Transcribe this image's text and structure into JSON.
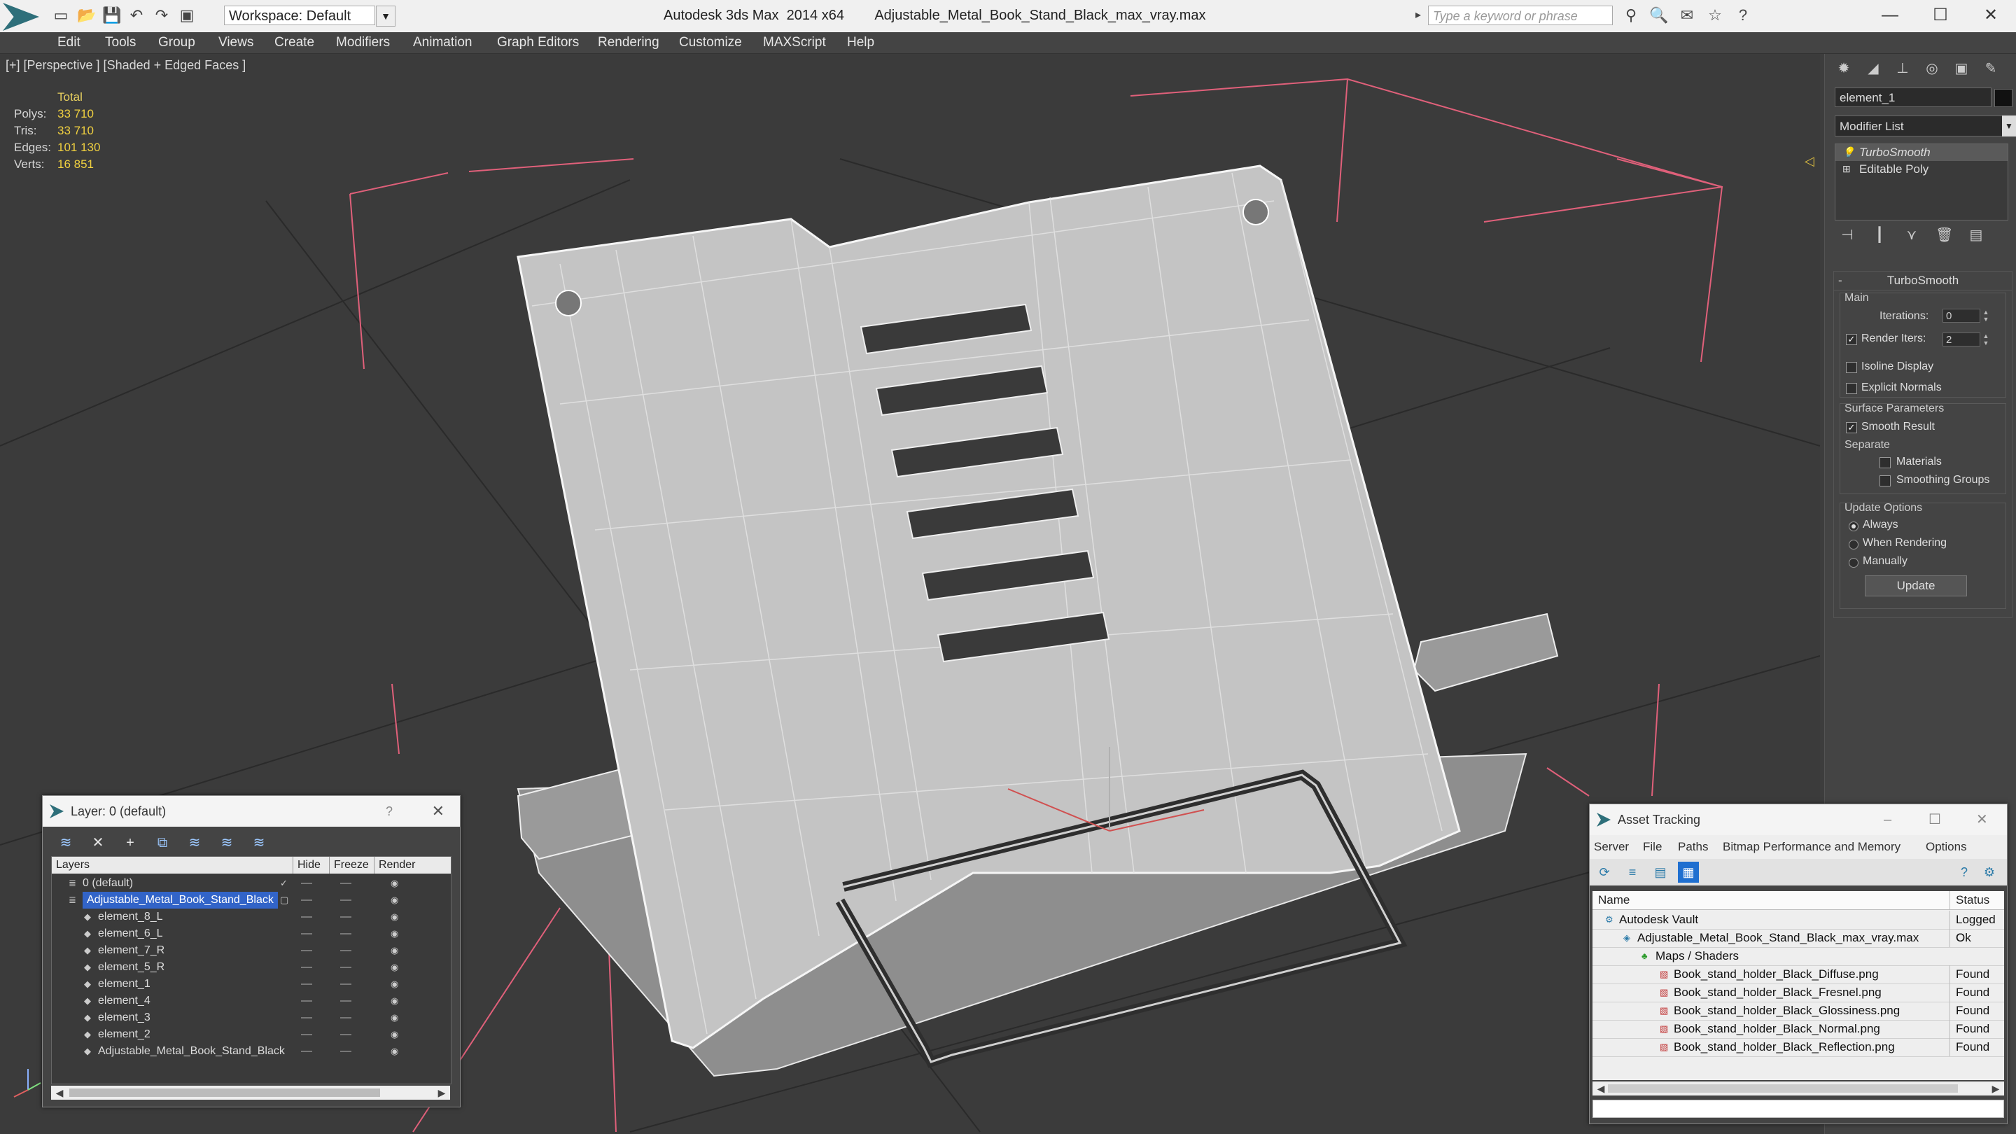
{
  "window": {
    "app_title": "Autodesk 3ds Max  2014 x64",
    "file_name": "Adjustable_Metal_Book_Stand_Black_max_vray.max",
    "workspace": "Workspace: Default",
    "search_placeholder": "Type a keyword or phrase"
  },
  "menu": [
    "Edit",
    "Tools",
    "Group",
    "Views",
    "Create",
    "Modifiers",
    "Animation",
    "Graph Editors",
    "Rendering",
    "Customize",
    "MAXScript",
    "Help"
  ],
  "viewport": {
    "label": "[+] [Perspective ] [Shaded + Edged Faces ]",
    "stats": {
      "header": "Total",
      "rows": [
        {
          "label": "Polys:",
          "value": "33 710"
        },
        {
          "label": "Tris:",
          "value": "33 710"
        },
        {
          "label": "Edges:",
          "value": "101 130"
        },
        {
          "label": "Verts:",
          "value": "16 851"
        }
      ]
    }
  },
  "command_panel": {
    "object_name": "element_1",
    "modifier_list": "Modifier List",
    "stack": [
      "TurboSmooth",
      "Editable Poly"
    ],
    "rollout_title": "TurboSmooth",
    "main_label": "Main",
    "iterations_label": "Iterations:",
    "iterations_value": "0",
    "render_iters_label": "Render Iters:",
    "render_iters_value": "2",
    "isoline": "Isoline Display",
    "explicit_normals": "Explicit Normals",
    "surface_params": "Surface Parameters",
    "smooth_result": "Smooth Result",
    "separate": "Separate",
    "materials": "Materials",
    "smoothing_groups": "Smoothing Groups",
    "update_options": "Update Options",
    "always": "Always",
    "when_rendering": "When Rendering",
    "manually": "Manually",
    "update_button": "Update"
  },
  "layer_window": {
    "title": "Layer: 0 (default)",
    "help": "?",
    "columns": [
      "Layers",
      "Hide",
      "Freeze",
      "Render"
    ],
    "rows": [
      {
        "name": "0 (default)",
        "level": 0
      },
      {
        "name": "Adjustable_Metal_Book_Stand_Black",
        "level": 0
      },
      {
        "name": "element_8_L",
        "level": 1
      },
      {
        "name": "element_6_L",
        "level": 1
      },
      {
        "name": "element_7_R",
        "level": 1
      },
      {
        "name": "element_5_R",
        "level": 1
      },
      {
        "name": "element_1",
        "level": 1
      },
      {
        "name": "element_4",
        "level": 1
      },
      {
        "name": "element_3",
        "level": 1
      },
      {
        "name": "element_2",
        "level": 1
      },
      {
        "name": "Adjustable_Metal_Book_Stand_Black",
        "level": 1
      }
    ]
  },
  "asset_window": {
    "title": "Asset Tracking",
    "menu": [
      "Server",
      "File",
      "Paths",
      "Bitmap Performance and Memory",
      "Options"
    ],
    "columns": [
      "Name",
      "Status"
    ],
    "rows": [
      {
        "name": "Autodesk Vault",
        "status": "Logged C",
        "level": 0
      },
      {
        "name": "Adjustable_Metal_Book_Stand_Black_max_vray.max",
        "status": "Ok",
        "level": 1
      },
      {
        "name": "Maps / Shaders",
        "status": "",
        "level": 2
      },
      {
        "name": "Book_stand_holder_Black_Diffuse.png",
        "status": "Found",
        "level": 3
      },
      {
        "name": "Book_stand_holder_Black_Fresnel.png",
        "status": "Found",
        "level": 3
      },
      {
        "name": "Book_stand_holder_Black_Glossiness.png",
        "status": "Found",
        "level": 3
      },
      {
        "name": "Book_stand_holder_Black_Normal.png",
        "status": "Found",
        "level": 3
      },
      {
        "name": "Book_stand_holder_Black_Reflection.png",
        "status": "Found",
        "level": 3
      }
    ]
  },
  "colors": {
    "viewport_bg": "#3b3b3b",
    "panel_bg": "#444444",
    "stats_value": "#f0d040",
    "selection": "#3264c8",
    "bbox_lines": "#e0607a"
  }
}
